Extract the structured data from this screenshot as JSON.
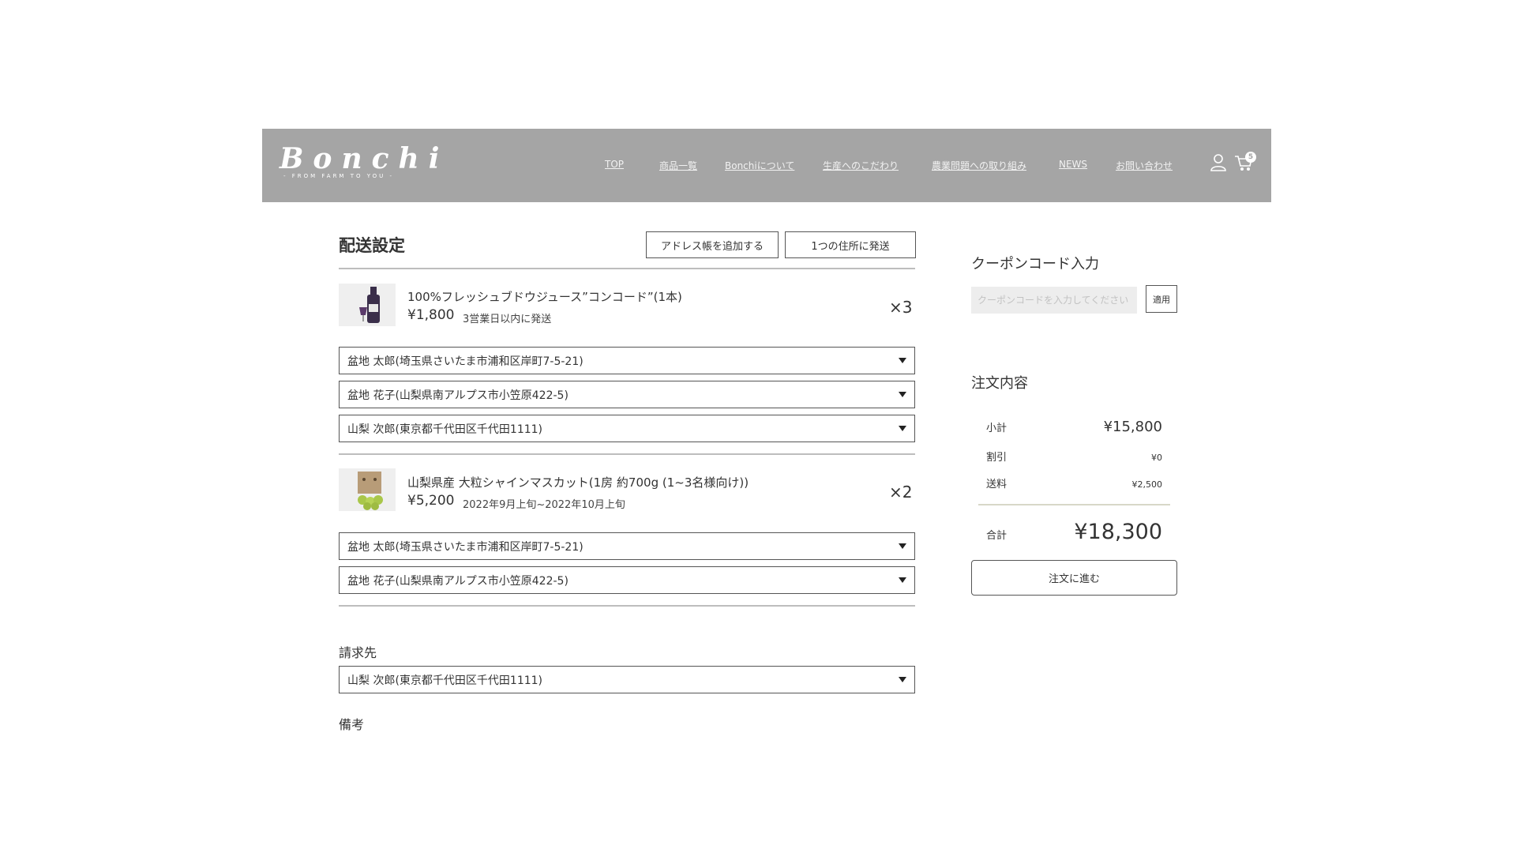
{
  "header": {
    "logo": "Bonchi",
    "logo_sub": "- FROM FARM TO YOU -",
    "nav": [
      "TOP",
      "商品一覧",
      "Bonchiについて",
      "生産へのこだわり",
      "農業問題への取り組み",
      "NEWS",
      "お問い合わせ"
    ],
    "cart_count": "5",
    "icons": [
      "user-icon",
      "cart-icon"
    ]
  },
  "shipping": {
    "title": "配送設定",
    "add_address_label": "アドレス帳を追加する",
    "single_address_label": "1つの住所に発送"
  },
  "items": [
    {
      "name": "100%フレッシュブドウジュース”コンコード”(1本)",
      "price": "¥1,800",
      "note": "3営業日以内に発送",
      "qty": "×3",
      "addresses": [
        "盆地 太郎(埼玉県さいたま市浦和区岸町7-5-21)",
        "盆地 花子(山梨県南アルプス市小笠原422-5)",
        "山梨 次郎(東京都千代田区千代田1111)"
      ]
    },
    {
      "name": "山梨県産 大粒シャインマスカット(1房 約700g (1~3名様向け))",
      "price": "¥5,200",
      "note": "2022年9月上旬~2022年10月上旬",
      "qty": "×2",
      "addresses": [
        "盆地 太郎(埼玉県さいたま市浦和区岸町7-5-21)",
        "盆地 花子(山梨県南アルプス市小笠原422-5)"
      ]
    }
  ],
  "billing": {
    "label": "請求先",
    "value": "山梨 次郎(東京都千代田区千代田1111)"
  },
  "remarks_label": "備考",
  "coupon": {
    "title": "クーポンコード入力",
    "placeholder": "クーポンコードを入力してください",
    "apply_label": "適用"
  },
  "summary": {
    "title": "注文内容",
    "subtotal_label": "小計",
    "subtotal": "¥15,800",
    "discount_label": "割引",
    "discount": "¥0",
    "shipping_label": "送料",
    "shipping": "¥2,500",
    "total_label": "合計",
    "total": "¥18,300",
    "proceed_label": "注文に進む"
  },
  "colors": {
    "header_bg": "#a5a5a5",
    "border": "#555555",
    "text": "#333333"
  }
}
